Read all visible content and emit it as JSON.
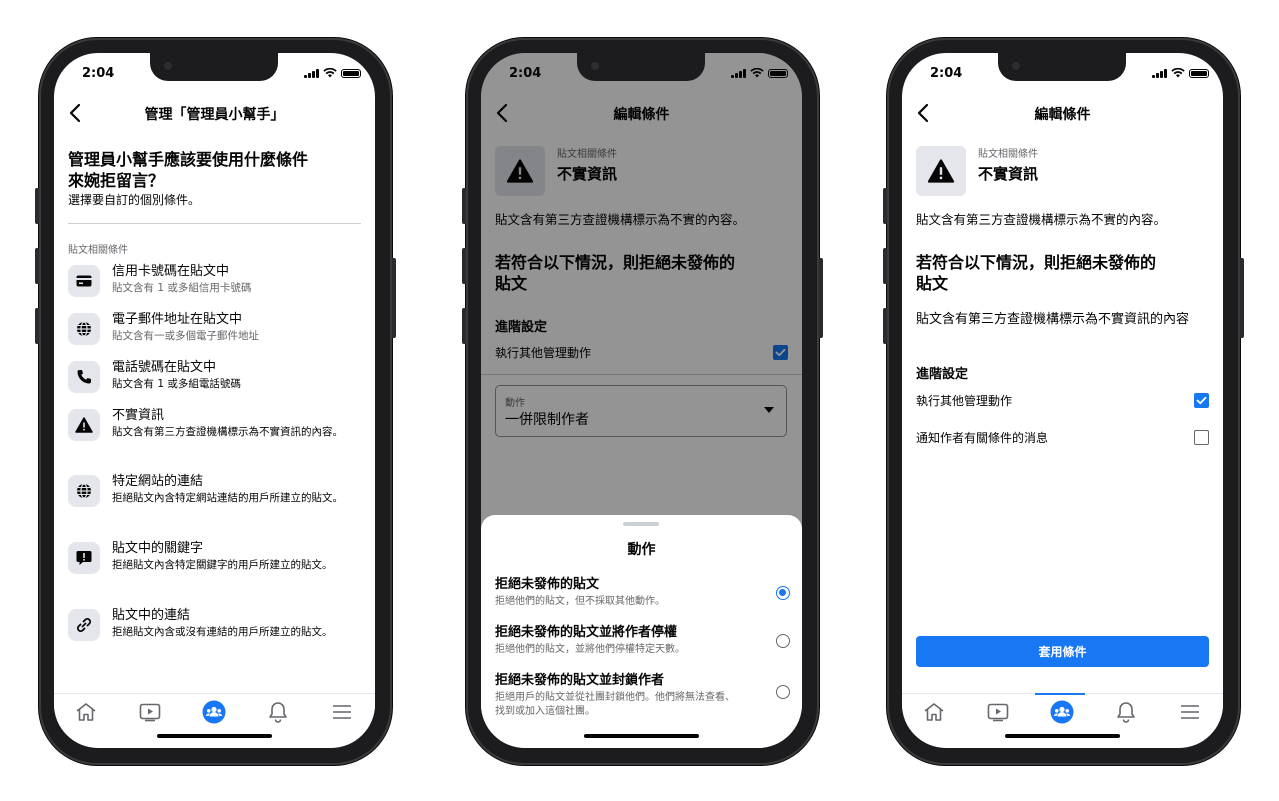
{
  "status": {
    "time": "2:04"
  },
  "phone1": {
    "title": "管理「管理員小幫手」",
    "question_line1": "管理員小幫手應該要使用什麼條件",
    "question_line2": "來婉拒留言？",
    "subtitle": "選擇要自訂的個別條件。",
    "section": "貼文相關條件",
    "items": [
      {
        "icon": "credit-card-icon",
        "title": "信用卡號碼在貼文中",
        "desc": "貼文含有 1 或多組信用卡號碼"
      },
      {
        "icon": "globe-icon",
        "title": "電子郵件地址在貼文中",
        "desc": "貼文含有一或多個電子郵件地址"
      },
      {
        "icon": "phone-icon",
        "title": "電話號碼在貼文中",
        "desc": "貼文含有 1 或多組電話號碼"
      },
      {
        "icon": "warning-icon",
        "title": "不實資訊",
        "desc": "貼文含有第三方查證機構標示為不實資訊的內容。"
      },
      {
        "icon": "globe-icon",
        "title": "特定網站的連結",
        "desc": "拒絕貼文內含特定網站連結的用戶所建立的貼文。"
      },
      {
        "icon": "exclamation-chat-icon",
        "title": "貼文中的關鍵字",
        "desc": "拒絕貼文內含特定關鍵字的用戶所建立的貼文。"
      },
      {
        "icon": "link-icon",
        "title": "貼文中的連結",
        "desc": "拒絕貼文內含或沒有連結的用戶所建立的貼文。"
      }
    ]
  },
  "phone2": {
    "title": "編輯條件",
    "category": "貼文相關條件",
    "condition_title": "不實資訊",
    "condition_desc": "貼文含有第三方查證機構標示為不實的內容。",
    "rule_heading_line1": "若符合以下情況，則拒絕未發佈的",
    "rule_heading_line2": "貼文",
    "advanced": "進階設定",
    "more_actions": "執行其他管理動作",
    "select_label": "動作",
    "select_value": "一併限制作者",
    "sheet_title": "動作",
    "options": [
      {
        "title": "拒絕未發佈的貼文",
        "desc": "拒絕他們的貼文，但不採取其他動作。",
        "selected": true
      },
      {
        "title": "拒絕未發佈的貼文並將作者停權",
        "desc": "拒絕他們的貼文，並將他們停權特定天數。",
        "selected": false
      },
      {
        "title": "拒絕未發佈的貼文並封鎖作者",
        "desc": "拒絕用戶的貼文並從社團封鎖他們。他們將無法查看、找到或加入這個社團。",
        "selected": false
      }
    ]
  },
  "phone3": {
    "title": "編輯條件",
    "category": "貼文相關條件",
    "condition_title": "不實資訊",
    "condition_desc": "貼文含有第三方查證機構標示為不實的內容。",
    "rule_heading_line1": "若符合以下情況，則拒絕未發佈的",
    "rule_heading_line2": "貼文",
    "rule_desc": "貼文含有第三方查證機構標示為不實資訊的內容",
    "advanced": "進階設定",
    "more_actions": "執行其他管理動作",
    "notify": "通知作者有關條件的消息",
    "apply_button": "套用條件"
  },
  "nav": [
    "home-icon",
    "video-icon",
    "groups-icon",
    "bell-icon",
    "menu-icon"
  ],
  "colors": {
    "accent": "#1877f2",
    "text": "#050505",
    "secondary": "#65676b"
  }
}
